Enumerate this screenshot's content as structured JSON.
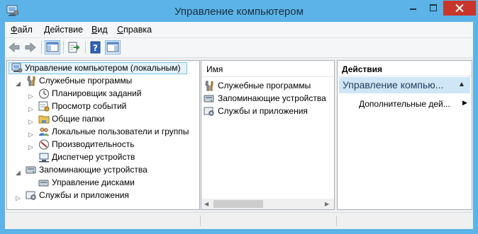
{
  "window": {
    "title": "Управление компьютером"
  },
  "menu": {
    "file": {
      "accel": "Ф",
      "rest": "айл"
    },
    "action": {
      "accel": "Д",
      "rest": "ействие"
    },
    "view": {
      "accel": "В",
      "rest": "ид"
    },
    "help": {
      "accel": "С",
      "rest": "правка"
    }
  },
  "toolbar": {
    "icons": [
      "back-arrow-icon",
      "forward-arrow-icon",
      "show-console-tree-icon",
      "export-list-icon",
      "help-icon",
      "show-action-pane-icon"
    ]
  },
  "tree": {
    "root": "Управление компьютером (локальным)",
    "system_tools": "Служебные программы",
    "task_scheduler": "Планировщик заданий",
    "event_viewer": "Просмотр событий",
    "shared_folders": "Общие папки",
    "local_users": "Локальные пользователи и группы",
    "performance": "Производительность",
    "device_manager": "Диспетчер устройств",
    "storage": "Запоминающие устройства",
    "disk_management": "Управление дисками",
    "services": "Службы и приложения"
  },
  "list": {
    "column_name": "Имя",
    "items": [
      "Служебные программы",
      "Запоминающие устройства",
      "Службы и приложения"
    ]
  },
  "actions": {
    "header": "Действия",
    "selected": "Управление компью...",
    "more": "Дополнительные дей..."
  },
  "colors": {
    "titlebar": "#5bb3e7",
    "close": "#c8362b",
    "selection": "#e5f3fb",
    "action_selection": "#cfe6f6"
  }
}
